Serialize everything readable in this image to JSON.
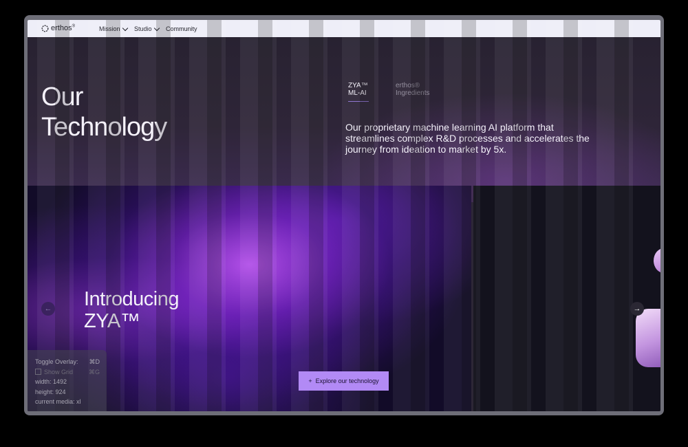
{
  "nav": {
    "logo": "erthos",
    "logo_mark": "®",
    "items": [
      {
        "label": "Mission",
        "has_dropdown": true
      },
      {
        "label": "Studio",
        "has_dropdown": true
      },
      {
        "label": "Community",
        "has_dropdown": false
      }
    ]
  },
  "hero": {
    "title_line1": "Our",
    "title_line2": "Technology",
    "tabs": [
      {
        "line1": "ZYA™",
        "line2": "ML-AI",
        "active": true
      },
      {
        "line1": "erthos®",
        "line2": "Ingredients",
        "active": false
      }
    ],
    "description": "Our proprietary machine learning AI platform that streamlines complex R&D processes and accelerates the journey from ideation to market by 5x."
  },
  "carousel": {
    "slide_title_line1": "Introducing",
    "slide_title_line2": "ZYA™",
    "cta_label": "Explore our technology",
    "cta_icon": "plus-icon",
    "prev_icon": "arrow-left-icon",
    "next_icon": "arrow-right-icon"
  },
  "debug_overlay": {
    "toggle_label": "Toggle Overlay:",
    "toggle_shortcut": "⌘D",
    "grid_label": "Show Grid",
    "grid_shortcut": "⌘G",
    "width": "width: 1492",
    "height": "height: 924",
    "media": "current media: xl"
  },
  "colors": {
    "accent": "#b28af5",
    "background": "#2c2438",
    "nav_bg": "#eeeef8",
    "text": "#f4f1fa"
  }
}
